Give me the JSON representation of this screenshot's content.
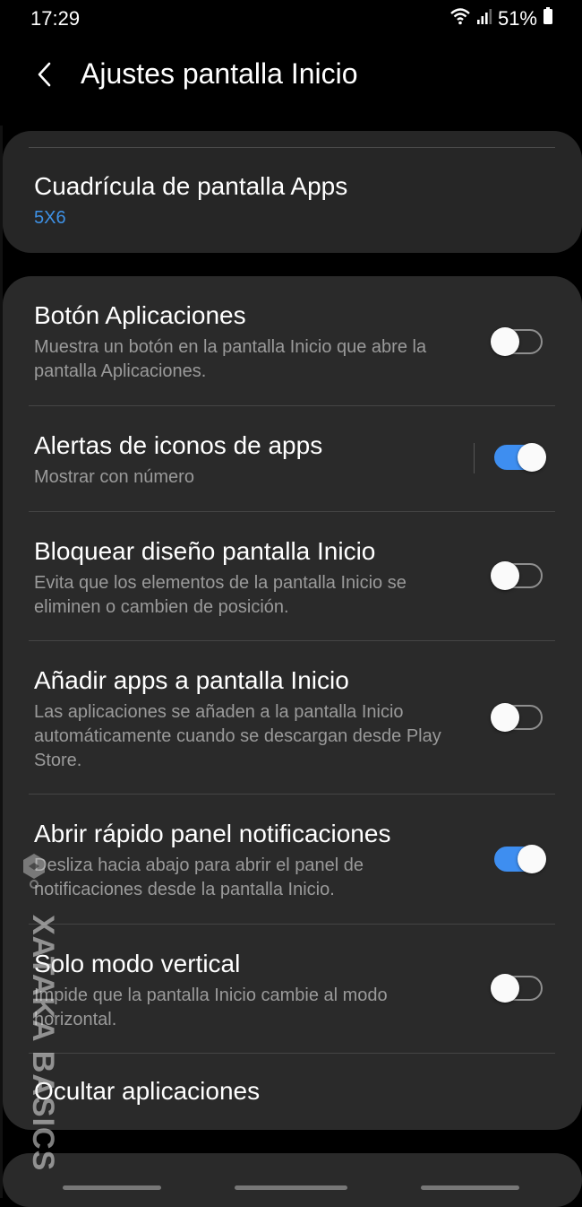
{
  "status_bar": {
    "time": "17:29",
    "battery": "51%",
    "icons": [
      "wifi-icon",
      "signal-icon",
      "battery-icon"
    ]
  },
  "header": {
    "back_icon": "chevron-left-icon",
    "title": "Ajustes pantalla Inicio"
  },
  "grid": {
    "title": "Cuadrícula de pantalla Apps",
    "value": "5X6"
  },
  "settings": [
    {
      "title": "Botón Aplicaciones",
      "desc": "Muestra un botón en la pantalla Inicio que abre la pantalla Aplicaciones.",
      "enabled": false
    },
    {
      "title": "Alertas de iconos de apps",
      "desc": "Mostrar con número",
      "enabled": true
    },
    {
      "title": "Bloquear diseño pantalla Inicio",
      "desc": "Evita que los elementos de la pantalla Inicio se eliminen o cambien de posición.",
      "enabled": false
    },
    {
      "title": "Añadir apps a pantalla Inicio",
      "desc": "Las aplicaciones se añaden a la pantalla Inicio automáticamente cuando se descargan desde Play Store.",
      "enabled": false
    },
    {
      "title": "Abrir rápido panel notificaciones",
      "desc": "Desliza hacia abajo para abrir el panel de notificaciones desde la pantalla Inicio.",
      "enabled": true
    },
    {
      "title": "Solo modo vertical",
      "desc": "Impide que la pantalla Inicio cambie al modo horizontal.",
      "enabled": false
    }
  ],
  "hide_apps": {
    "title": "Ocultar aplicaciones"
  },
  "watermark": "XATAKA BASICS",
  "colors": {
    "accent": "#3e8ef0",
    "link": "#3e91e6",
    "card": "#2a2a2a",
    "background": "#000000"
  }
}
